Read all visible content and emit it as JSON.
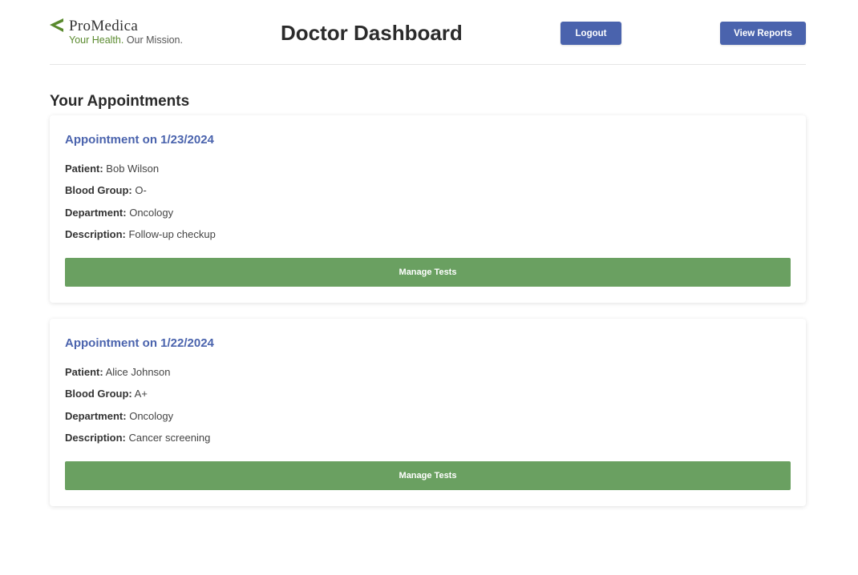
{
  "brand": {
    "name": "ProMedica",
    "tagline_part1": "Your Health.",
    "tagline_part2": "Our Mission.",
    "colors": {
      "green": "#5a8a2e",
      "dark": "#333333"
    }
  },
  "header": {
    "title": "Doctor Dashboard",
    "logout_label": "Logout",
    "view_reports_label": "View Reports"
  },
  "section": {
    "title": "Your Appointments"
  },
  "labels": {
    "patient": "Patient:",
    "blood_group": "Blood Group:",
    "department": "Department:",
    "description": "Description:"
  },
  "appointments": [
    {
      "title": "Appointment on 1/23/2024",
      "patient": "Bob Wilson",
      "blood_group": "O-",
      "department": "Oncology",
      "description": "Follow-up checkup",
      "action_label": "Manage Tests"
    },
    {
      "title": "Appointment on 1/22/2024",
      "patient": "Alice Johnson",
      "blood_group": "A+",
      "department": "Oncology",
      "description": "Cancer screening",
      "action_label": "Manage Tests"
    }
  ],
  "colors": {
    "accent_blue": "#4a63ad",
    "action_green": "#6aa061"
  }
}
